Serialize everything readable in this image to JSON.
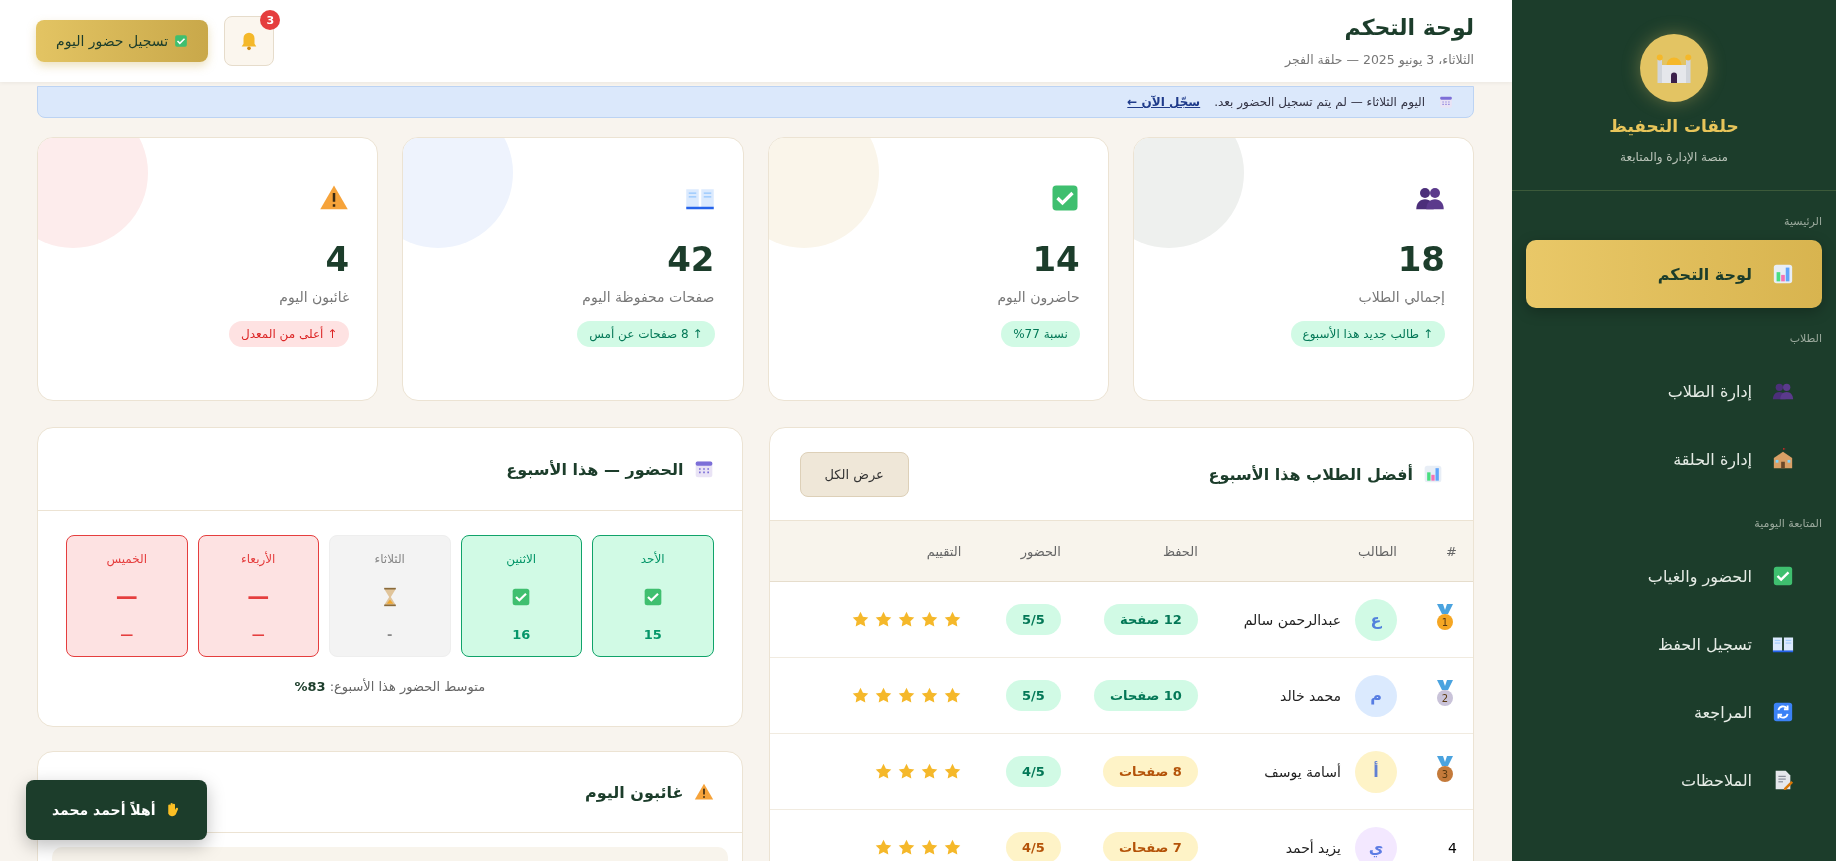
{
  "sidebar": {
    "brand": {
      "title": "حلقات التحفيظ",
      "subtitle": "منصة الإدارة والمتابعة"
    },
    "sections": [
      {
        "heading": "الرئيسية",
        "items": [
          {
            "label": "لوحة التحكم",
            "kind": "chart",
            "selected": true
          }
        ]
      },
      {
        "heading": "الطلاب",
        "items": [
          {
            "label": "إدارة الطلاب",
            "kind": "people",
            "selected": false
          },
          {
            "label": "إدارة الحلقة",
            "kind": "school",
            "selected": false
          }
        ]
      },
      {
        "heading": "المتابعة اليومية",
        "items": [
          {
            "label": "الحضور والغياب",
            "kind": "check",
            "selected": false
          },
          {
            "label": "تسجيل الحفظ",
            "kind": "book",
            "selected": false
          },
          {
            "label": "المراجعة",
            "kind": "refresh",
            "selected": false
          },
          {
            "label": "الملاحظات",
            "kind": "note",
            "selected": false
          }
        ]
      }
    ]
  },
  "header": {
    "title": "لوحة التحكم",
    "subtitle": "الثلاثاء، 3 يونيو 2025 — حلقة الفجر",
    "notification_count": "3",
    "action": "تسجيل حضور اليوم"
  },
  "banner": {
    "text": "اليوم الثلاثاء — لم يتم تسجيل الحضور بعد.",
    "link": "سجّل الآن ←"
  },
  "stats": [
    {
      "kind": "people",
      "value": "18",
      "label": "إجمالي الطلاب",
      "trend": {
        "text": "↑ طالب جديد هذا الأسبوع",
        "kind": "up"
      },
      "color": "#eef0ee"
    },
    {
      "kind": "check",
      "value": "14",
      "label": "حاضرون اليوم",
      "trend": {
        "text": "نسبة 77%",
        "kind": "up"
      },
      "color": "#faf5ea"
    },
    {
      "kind": "book",
      "value": "42",
      "label": "صفحات محفوظة اليوم",
      "trend": {
        "text": "↑ 8 صفحات عن أمس",
        "kind": "up"
      },
      "color": "#eef3fd"
    },
    {
      "kind": "warning",
      "value": "4",
      "label": "غائبون اليوم",
      "trend": {
        "text": "↑ أعلى من المعدل",
        "kind": "down"
      },
      "color": "#fdecec"
    }
  ],
  "top_students": {
    "title": "أفضل الطلاب هذا الأسبوع",
    "button": "عرض الكل",
    "columns": [
      "#",
      "الطالب",
      "الحفظ",
      "الحضور",
      "التقييم"
    ],
    "rows": [
      {
        "kind": "medal",
        "rank": "1",
        "initial": "ع",
        "color": "#d1fae5",
        "name": "عبدالرحمن سالم",
        "memorized": {
          "text": "12 صفحة",
          "kind": "good"
        },
        "attendance": {
          "text": "5/5",
          "kind": "good"
        },
        "stars": 5
      },
      {
        "kind": "medal",
        "rank": "2",
        "initial": "م",
        "color": "#dbeafe",
        "name": "محمد خالد",
        "memorized": {
          "text": "10 صفحات",
          "kind": "good"
        },
        "attendance": {
          "text": "5/5",
          "kind": "good"
        },
        "stars": 5
      },
      {
        "kind": "medal",
        "rank": "3",
        "initial": "أ",
        "color": "#fef3c7",
        "name": "أسامة يوسف",
        "memorized": {
          "text": "8 صفحات",
          "kind": "fair"
        },
        "attendance": {
          "text": "4/5",
          "kind": "good"
        },
        "stars": 4
      },
      {
        "kind": "number",
        "rank": "4",
        "initial": "ي",
        "color": "#f3e8ff",
        "name": "يزيد أحمد",
        "memorized": {
          "text": "7 صفحات",
          "kind": "fair"
        },
        "attendance": {
          "text": "4/5",
          "kind": "fair"
        },
        "stars": 4
      }
    ]
  },
  "week": {
    "title": "الحضور — هذا الأسبوع",
    "days": [
      {
        "day": "الأحد",
        "kind": "present",
        "count": "15"
      },
      {
        "day": "الاثنين",
        "kind": "present",
        "count": "16"
      },
      {
        "day": "الثلاثاء",
        "kind": "pending",
        "count": "-"
      },
      {
        "day": "الأربعاء",
        "kind": "absent",
        "symbol": "—",
        "count": "—"
      },
      {
        "day": "الخميس",
        "kind": "absent",
        "symbol": "—",
        "count": "—"
      }
    ],
    "summary": "متوسط الحضور هذا الأسبوع: **83%**"
  },
  "absent_today": {
    "title": "غائبون اليوم"
  },
  "toast": {
    "text": "أهلاً أحمد محمد"
  }
}
